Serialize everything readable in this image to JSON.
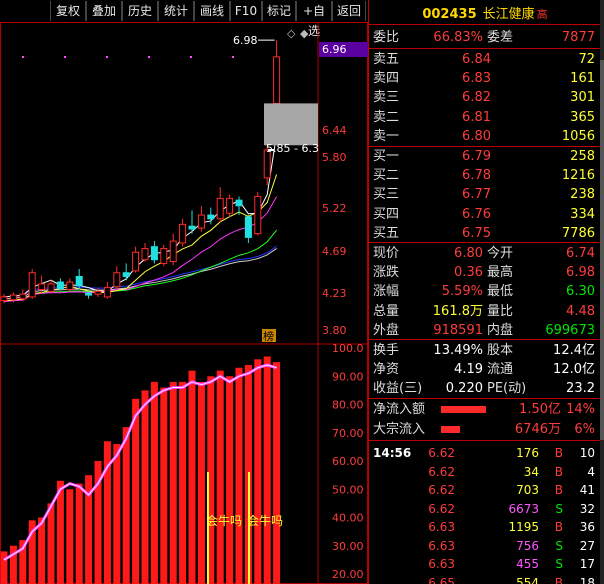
{
  "toolbar": {
    "buttons": [
      "复权",
      "叠加",
      "历史",
      "统计",
      "画线",
      "F10",
      "标记",
      "+自选",
      "返回"
    ]
  },
  "chart": {
    "price_axis_labels": [
      "6.96",
      "6.44",
      "5.80",
      "5.22",
      "4.69",
      "4.23",
      "3.80"
    ],
    "indicator_axis_labels": [
      "100.0",
      "90.00",
      "80.00",
      "70.00",
      "60.00",
      "50.00",
      "40.00",
      "30.00",
      "20.00"
    ],
    "high_annotation": "6.98",
    "gap_annotation": "5.85 - 6.3",
    "bang_badge": "榜",
    "signal_labels": [
      "会牛吗",
      "会牛吗"
    ],
    "colors": {
      "up": "#ff2a2a",
      "down": "#22e0e0",
      "highlight": "#5a00a0"
    }
  },
  "chart_data": {
    "type": "candlestick",
    "price_ylim": [
      3.8,
      6.96
    ],
    "candles": [
      {
        "o": 4.18,
        "c": 4.22,
        "h": 4.25,
        "l": 4.15
      },
      {
        "o": 4.19,
        "c": 4.24,
        "h": 4.27,
        "l": 4.16
      },
      {
        "o": 4.2,
        "c": 4.25,
        "h": 4.3,
        "l": 4.17
      },
      {
        "o": 4.22,
        "c": 4.48,
        "h": 4.52,
        "l": 4.2
      },
      {
        "o": 4.3,
        "c": 4.36,
        "h": 4.45,
        "l": 4.25
      },
      {
        "o": 4.28,
        "c": 4.36,
        "h": 4.4,
        "l": 4.26
      },
      {
        "o": 4.38,
        "c": 4.31,
        "h": 4.42,
        "l": 4.29
      },
      {
        "o": 4.3,
        "c": 4.38,
        "h": 4.42,
        "l": 4.28
      },
      {
        "o": 4.44,
        "c": 4.34,
        "h": 4.52,
        "l": 4.3
      },
      {
        "o": 4.26,
        "c": 4.24,
        "h": 4.3,
        "l": 4.2
      },
      {
        "o": 4.25,
        "c": 4.28,
        "h": 4.32,
        "l": 4.22
      },
      {
        "o": 4.22,
        "c": 4.32,
        "h": 4.38,
        "l": 4.2
      },
      {
        "o": 4.33,
        "c": 4.48,
        "h": 4.55,
        "l": 4.3
      },
      {
        "o": 4.48,
        "c": 4.44,
        "h": 4.58,
        "l": 4.4
      },
      {
        "o": 4.5,
        "c": 4.7,
        "h": 4.76,
        "l": 4.48
      },
      {
        "o": 4.62,
        "c": 4.74,
        "h": 4.8,
        "l": 4.6
      },
      {
        "o": 4.76,
        "c": 4.62,
        "h": 4.82,
        "l": 4.58
      },
      {
        "o": 4.58,
        "c": 4.74,
        "h": 4.78,
        "l": 4.55
      },
      {
        "o": 4.6,
        "c": 4.82,
        "h": 4.9,
        "l": 4.56
      },
      {
        "o": 4.8,
        "c": 5.0,
        "h": 5.06,
        "l": 4.76
      },
      {
        "o": 4.98,
        "c": 4.95,
        "h": 5.15,
        "l": 4.9
      },
      {
        "o": 4.96,
        "c": 5.1,
        "h": 5.2,
        "l": 4.92
      },
      {
        "o": 5.1,
        "c": 5.06,
        "h": 5.18,
        "l": 5.0
      },
      {
        "o": 5.06,
        "c": 5.28,
        "h": 5.4,
        "l": 5.02
      },
      {
        "o": 5.12,
        "c": 5.28,
        "h": 5.32,
        "l": 5.08
      },
      {
        "o": 5.26,
        "c": 5.2,
        "h": 5.3,
        "l": 5.1
      },
      {
        "o": 5.08,
        "c": 4.86,
        "h": 5.1,
        "l": 4.8
      },
      {
        "o": 4.9,
        "c": 5.3,
        "h": 5.35,
        "l": 4.88
      },
      {
        "o": 5.5,
        "c": 5.8,
        "h": 5.85,
        "l": 5.42
      },
      {
        "o": 6.3,
        "c": 6.8,
        "h": 6.98,
        "l": 6.28
      }
    ],
    "indicator_ylim": [
      20,
      100
    ],
    "indicator_bars": [
      28,
      30,
      32,
      39,
      40,
      45,
      53,
      50,
      52,
      55,
      60,
      67,
      66,
      72,
      82,
      85,
      88,
      86,
      88,
      88,
      92,
      88,
      90,
      92,
      90,
      93,
      94,
      96,
      97,
      95
    ],
    "indicator_line": [
      25,
      27,
      29,
      35,
      38,
      44,
      50,
      52,
      51,
      48,
      52,
      58,
      62,
      68,
      76,
      80,
      83,
      85,
      86,
      86,
      88,
      87,
      88,
      90,
      88,
      90,
      91,
      93,
      94,
      93
    ]
  },
  "quote": {
    "code": "002435",
    "name": "长江健康",
    "tag": "高",
    "webi_label": "委比",
    "webi_value": "66.83%",
    "weicha_label": "委差",
    "weicha_value": "7877",
    "asks": [
      {
        "label": "卖五",
        "price": "6.84",
        "vol": "72"
      },
      {
        "label": "卖四",
        "price": "6.83",
        "vol": "161"
      },
      {
        "label": "卖三",
        "price": "6.82",
        "vol": "301"
      },
      {
        "label": "卖二",
        "price": "6.81",
        "vol": "365"
      },
      {
        "label": "卖一",
        "price": "6.80",
        "vol": "1056"
      }
    ],
    "bids": [
      {
        "label": "买一",
        "price": "6.79",
        "vol": "258"
      },
      {
        "label": "买二",
        "price": "6.78",
        "vol": "1216"
      },
      {
        "label": "买三",
        "price": "6.77",
        "vol": "238"
      },
      {
        "label": "买四",
        "price": "6.76",
        "vol": "334"
      },
      {
        "label": "买五",
        "price": "6.75",
        "vol": "7786"
      }
    ],
    "stats": [
      {
        "l1": "现价",
        "v1": "6.80",
        "l2": "今开",
        "v2": "6.74"
      },
      {
        "l1": "涨跌",
        "v1": "0.36",
        "l2": "最高",
        "v2": "6.98"
      },
      {
        "l1": "涨幅",
        "v1": "5.59%",
        "l2": "最低",
        "v2": "6.30"
      },
      {
        "l1": "总量",
        "v1": "161.8万",
        "l2": "量比",
        "v2": "4.48"
      },
      {
        "l1": "外盘",
        "v1": "918591",
        "l2": "内盘",
        "v2": "699673"
      }
    ],
    "fund": [
      {
        "l1": "换手",
        "v1": "13.49%",
        "l2": "股本",
        "v2": "12.4亿"
      },
      {
        "l1": "净资",
        "v1": "4.19",
        "l2": "流通",
        "v2": "12.0亿"
      },
      {
        "l1": "收益(三)",
        "v1": "0.220",
        "l2": "PE(动)",
        "v2": "23.2"
      }
    ],
    "flow": [
      {
        "label": "净流入额",
        "value": "1.50亿",
        "pct": "14%",
        "bar": 0.78
      },
      {
        "label": "大宗流入",
        "value": "6746万",
        "pct": "6%",
        "bar": 0.33
      }
    ],
    "ticks_time": "14:56",
    "ticks": [
      {
        "price": "6.62",
        "vol": "176",
        "side": "B",
        "n": "10"
      },
      {
        "price": "6.62",
        "vol": "34",
        "side": "B",
        "n": "4"
      },
      {
        "price": "6.62",
        "vol": "703",
        "side": "B",
        "n": "41"
      },
      {
        "price": "6.62",
        "vol": "6673",
        "side": "S",
        "n": "32"
      },
      {
        "price": "6.63",
        "vol": "1195",
        "side": "B",
        "n": "36"
      },
      {
        "price": "6.63",
        "vol": "756",
        "side": "S",
        "n": "27"
      },
      {
        "price": "6.63",
        "vol": "455",
        "side": "S",
        "n": "17"
      },
      {
        "price": "6.65",
        "vol": "554",
        "side": "B",
        "n": "18"
      }
    ]
  }
}
